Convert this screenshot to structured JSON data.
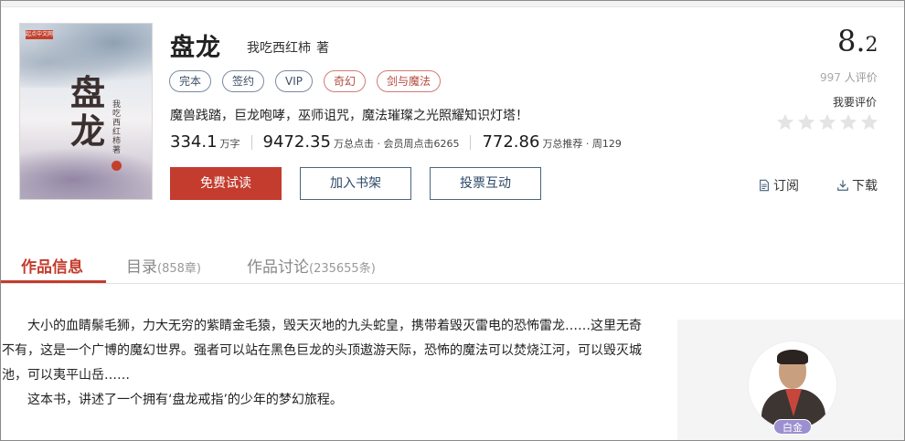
{
  "book": {
    "title": "盘龙",
    "author": "我吃西红柿",
    "author_suffix": "著",
    "tags": [
      "完本",
      "签约",
      "VIP",
      "奇幻",
      "剑与魔法"
    ],
    "intro": "魔兽践踏，巨龙咆哮，巫师诅咒，魔法璀璨之光照耀知识灯塔！",
    "cover": {
      "badge": "起点中文网",
      "big_title": "盘龙",
      "vertical_author": "我吃西红柿著"
    }
  },
  "stats": {
    "words": "334.1",
    "words_unit": "万字",
    "clicks": "9472.35",
    "clicks_unit": "万总点击 · 会员周点击6265",
    "recommends": "772.86",
    "recommends_unit": "万总推荐 · 周129"
  },
  "buttons": {
    "read": "免费试读",
    "shelf": "加入书架",
    "vote": "投票互动"
  },
  "rating": {
    "score_int": "8.",
    "score_dec": "2",
    "count": "997",
    "count_suffix": "人评价",
    "my_rate": "我要评价",
    "stars": 0
  },
  "actions": {
    "subscribe": "订阅",
    "download": "下载"
  },
  "tabs": [
    {
      "label": "作品信息",
      "count": ""
    },
    {
      "label": "目录",
      "count": "(858章)"
    },
    {
      "label": "作品讨论",
      "count": "(235655条)"
    }
  ],
  "description": {
    "p1_line1": "大小的血睛鬃毛狮，力大无穷的紫睛金毛猿，毁天灭地的九头蛇皇，携带着毁灭雷电的恐怖雷龙……这里无奇",
    "p1_line2": "不有，这是一个广博的魔幻世界。强者可以站在黑色巨龙的头顶遨游天际，恐怖的魔法可以焚烧江河，可以毁灭城",
    "p1_line3": "池，可以夷平山岳……",
    "p2": "这本书，讲述了一个拥有‘盘龙戒指’的少年的梦幻旅程。"
  },
  "author_panel": {
    "level": "白金"
  },
  "colors": {
    "accent": "#c33c2d",
    "outline": "#4a6481",
    "platinum": "#9c8fd0"
  }
}
